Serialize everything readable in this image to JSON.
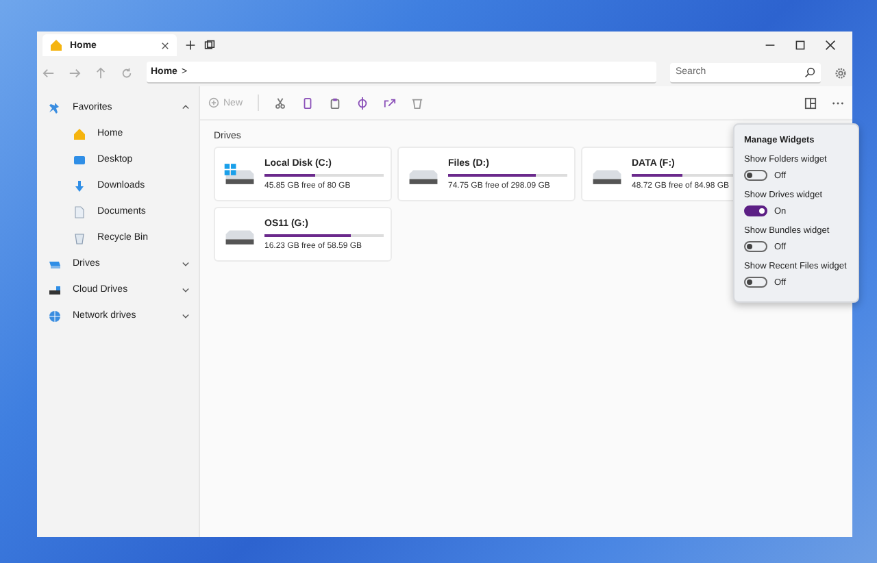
{
  "tab": {
    "title": "Home",
    "selected": true
  },
  "address": {
    "crumb": "Home",
    "separator": ">"
  },
  "search": {
    "placeholder": "Search"
  },
  "sidebar": {
    "items": [
      {
        "label": "Favorites",
        "kind": "star",
        "expanded": true,
        "children": [
          {
            "label": "Home",
            "kind": "home"
          },
          {
            "label": "Desktop",
            "kind": "desktop"
          },
          {
            "label": "Downloads",
            "kind": "downloads"
          },
          {
            "label": "Documents",
            "kind": "documents"
          },
          {
            "label": "Recycle Bin",
            "kind": "recycle"
          }
        ]
      },
      {
        "label": "Drives",
        "kind": "drives",
        "expanded": false
      },
      {
        "label": "Cloud Drives",
        "kind": "cloud",
        "expanded": false
      },
      {
        "label": "Network drives",
        "kind": "network",
        "expanded": false
      }
    ]
  },
  "toolbar": {
    "new_label": "New",
    "new_disabled": true
  },
  "section_title": "Drives",
  "drives": [
    {
      "name": "Local Disk (C:)",
      "kind": "system",
      "level": 0.43,
      "free": "45.85 GB free of 80 GB"
    },
    {
      "name": "Files (D:)",
      "kind": "disk",
      "level": 0.73,
      "free": "74.75 GB free of 298.09 GB"
    },
    {
      "name": "DATA (F:)",
      "kind": "disk",
      "level": 0.42,
      "free": "48.72 GB free of 84.98 GB"
    },
    {
      "name": "OS11 (G:)",
      "kind": "disk",
      "level": 0.72,
      "free": "16.23 GB free of 58.59 GB"
    }
  ],
  "widgets_menu": {
    "title": "Manage Widgets",
    "toggles": [
      {
        "label": "Show Folders widget",
        "on": false,
        "state": "Off"
      },
      {
        "label": "Show Drives widget",
        "on": true,
        "state": "On"
      },
      {
        "label": "Show Bundles widget",
        "on": false,
        "state": "Off"
      },
      {
        "label": "Show Recent Files widget",
        "on": false,
        "state": "Off"
      }
    ]
  }
}
